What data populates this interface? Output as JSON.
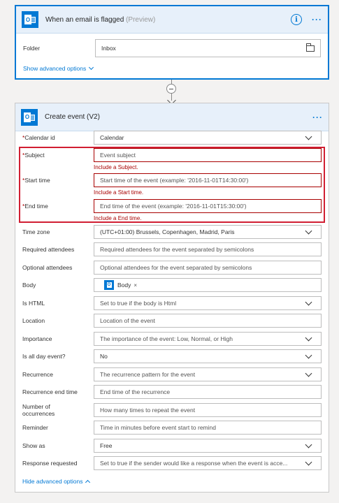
{
  "trigger": {
    "title": "When an email is flagged",
    "preview": "(Preview)",
    "folder_label": "Folder",
    "folder_value": "Inbox",
    "advanced_link": "Show advanced options"
  },
  "action": {
    "title": "Create event (V2)",
    "rows": {
      "calendar_id": {
        "label": "Calendar id",
        "required": "*",
        "value": "Calendar"
      },
      "subject": {
        "label": "Subject",
        "required": "*",
        "value": "Event subject",
        "error": "Include a Subject."
      },
      "start_time": {
        "label": "Start time",
        "required": "*",
        "value": "Start time of the event (example: '2016-11-01T14:30:00')",
        "error": "Include a Start time."
      },
      "end_time": {
        "label": "End time",
        "required": "*",
        "value": "End time of the event (example: '2016-11-01T15:30:00')",
        "error": "Include a End time."
      },
      "time_zone": {
        "label": "Time zone",
        "value": "(UTC+01:00) Brussels, Copenhagen, Madrid, Paris"
      },
      "required_attendees": {
        "label": "Required attendees",
        "value": "Required attendees for the event separated by semicolons"
      },
      "optional_attendees": {
        "label": "Optional attendees",
        "value": "Optional attendees for the event separated by semicolons"
      },
      "body": {
        "label": "Body",
        "token": "Body",
        "token_remove": "×"
      },
      "is_html": {
        "label": "Is HTML",
        "value": "Set to true if the body is Html"
      },
      "location": {
        "label": "Location",
        "value": "Location of the event"
      },
      "importance": {
        "label": "Importance",
        "value": "The importance of the event: Low, Normal, or High"
      },
      "is_all_day": {
        "label": "Is all day event?",
        "value": "No"
      },
      "recurrence": {
        "label": "Recurrence",
        "value": "The recurrence pattern for the event"
      },
      "recurrence_end": {
        "label": "Recurrence end time",
        "value": "End time of the recurrence"
      },
      "occurrences": {
        "label": "Number of occurrences",
        "value": "How many times to repeat the event"
      },
      "reminder": {
        "label": "Reminder",
        "value": "Time in minutes before event start to remind"
      },
      "show_as": {
        "label": "Show as",
        "value": "Free"
      },
      "response_requested": {
        "label": "Response requested",
        "value": "Set to true if the sender would like a response when the event is acce..."
      }
    },
    "advanced_link": "Hide advanced options"
  },
  "icons": {
    "outlook": "O",
    "info": "i",
    "more": "···"
  },
  "colors": {
    "accent": "#0078d4",
    "error": "#a80000",
    "error_box": "#d11e32",
    "header_bg": "#e7f0fa"
  }
}
